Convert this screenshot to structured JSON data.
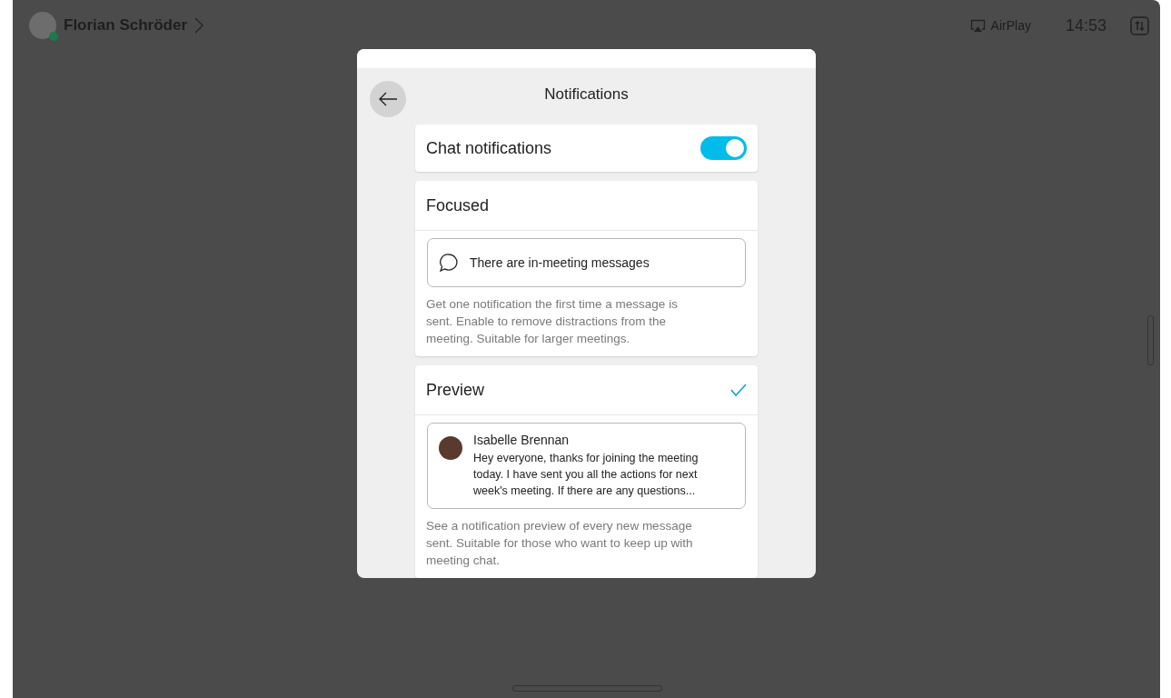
{
  "top_bar": {
    "user_name": "Florian Schröder",
    "presence": {
      "color": "#1a7a4a"
    },
    "airplay_label": "AirPlay",
    "time": "14:53"
  },
  "dialog": {
    "title": "Notifications",
    "chat_notifications": {
      "label": "Chat notifications",
      "on": true
    },
    "options": [
      {
        "title": "Focused",
        "selected": false,
        "example": {
          "kind": "hint",
          "text": "There are in-meeting messages"
        },
        "description": "Get one notification the first time a message is sent. Enable to remove distractions from the meeting. Suitable for larger meetings."
      },
      {
        "title": "Preview",
        "selected": true,
        "example": {
          "kind": "message",
          "sender": "Isabelle Brennan",
          "text": "Hey everyone, thanks for joining the meeting today. I have sent you all the actions for next week's meeting. If there are any questions..."
        },
        "description": "See a notification preview of every new message sent. Suitable for those who want to keep up with meeting chat."
      }
    ]
  }
}
